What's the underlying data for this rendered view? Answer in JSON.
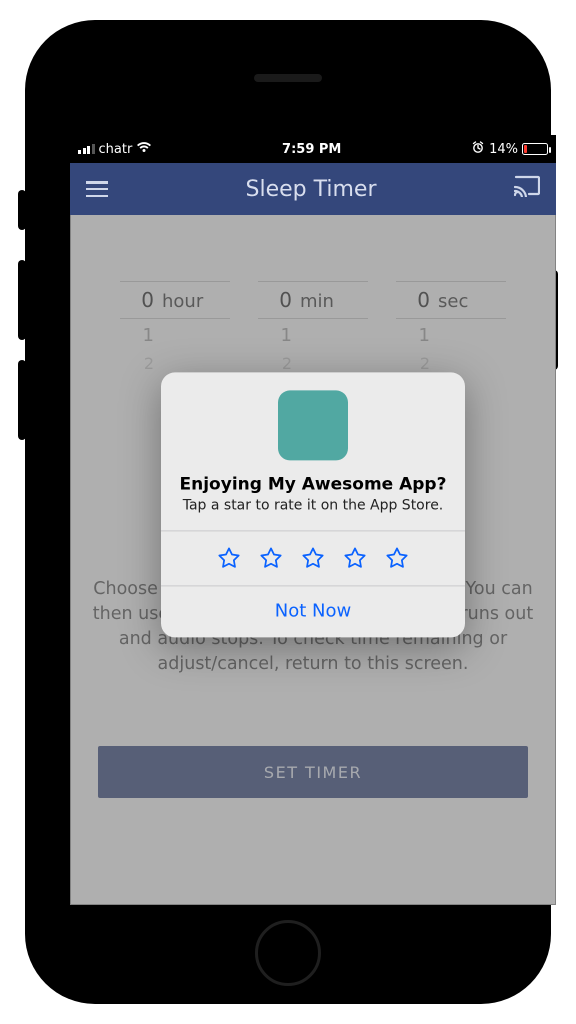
{
  "statusbar": {
    "carrier": "chatr",
    "time": "7:59 PM",
    "battery_pct": "14%"
  },
  "header": {
    "title": "Sleep Timer"
  },
  "timer": {
    "hour": {
      "sel": "0",
      "next1": "1",
      "next2": "2",
      "unit": "hour"
    },
    "min": {
      "sel": "0",
      "next1": "1",
      "next2": "2",
      "unit": "min"
    },
    "sec": {
      "sel": "0",
      "next1": "1",
      "next2": "2",
      "unit": "sec"
    }
  },
  "description": "Choose how long before the audio sleeps. You can then use the app normally until the timer runs out and audio stops. To check time remaining or adjust/cancel, return to this screen.",
  "set_button": "SET TIMER",
  "modal": {
    "title": "Enjoying My Awesome App?",
    "subtitle": "Tap a star to rate it on the App Store.",
    "cancel": "Not Now"
  }
}
